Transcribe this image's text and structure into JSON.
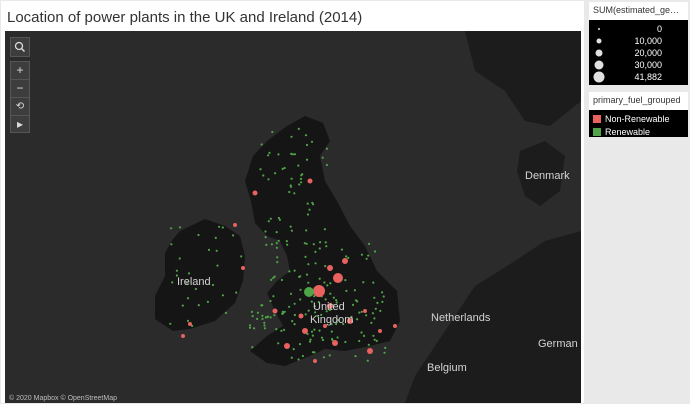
{
  "title": "Location of power plants in the UK and Ireland (2014)",
  "map": {
    "labels": {
      "denmark": "Denmark",
      "ireland": "Ireland",
      "united_kingdom_1": "United",
      "united_kingdom_2": "Kingdom",
      "netherlands": "Netherlands",
      "germany": "German",
      "belgium": "Belgium"
    },
    "attribution": "© 2020 Mapbox © OpenStreetMap",
    "controls": {
      "zoom_in": "+",
      "zoom_out": "−",
      "expand": "▸"
    }
  },
  "legend_size": {
    "title": "SUM(estimated_gener...",
    "entries": [
      "0",
      "10,000",
      "20,000",
      "30,000",
      "41,882"
    ]
  },
  "legend_color": {
    "title": "primary_fuel_grouped",
    "entries": [
      {
        "label": "Non-Renewable",
        "color": "#e8625f"
      },
      {
        "label": "Renewable",
        "color": "#4fa548"
      }
    ]
  },
  "colors": {
    "nonrenewable": "#e8625f",
    "renewable": "#4fa548",
    "land": "#1f1f1f",
    "sea": "#2b2b2b"
  }
}
